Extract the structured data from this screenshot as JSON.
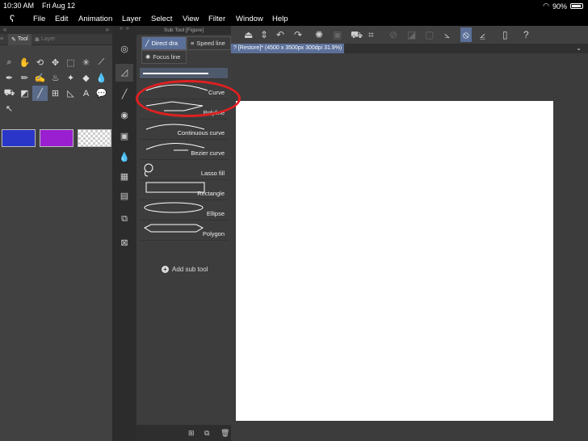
{
  "status": {
    "time": "10:30 AM",
    "date": "Fri Aug 12",
    "battery": "90%"
  },
  "menu": [
    "File",
    "Edit",
    "Animation",
    "Layer",
    "Select",
    "View",
    "Filter",
    "Window",
    "Help"
  ],
  "tool_panel": {
    "tab_tool": "Tool",
    "tab_layer": "Layer"
  },
  "subtool": {
    "title": "Sub Tool [Figure]",
    "tabs": {
      "direct": "Direct dra",
      "speed": "Speed line",
      "focus": "Focus line"
    },
    "items": [
      "Curve",
      "Polyline",
      "Continuous curve",
      "Bezier curve",
      "Lasso fill",
      "Rectangle",
      "Ellipse",
      "Polygon"
    ],
    "add_label": "Add sub tool"
  },
  "document": {
    "tab_title": "? [Restore]* (4500 x 3500px 300dpi 31.9%)"
  },
  "colors": {
    "swatch_main": "#2a36c8",
    "swatch_sub": "#9a1fd0",
    "highlight": "#e02020"
  }
}
